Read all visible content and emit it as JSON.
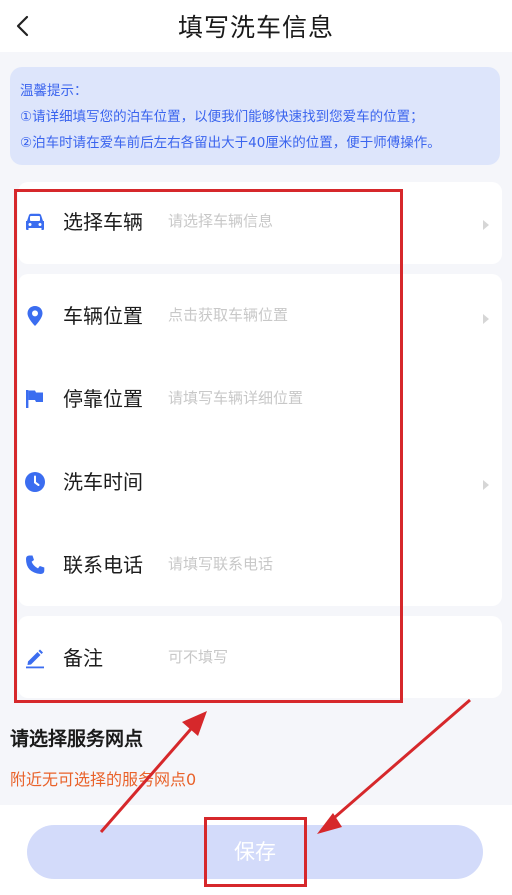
{
  "header": {
    "title": "填写洗车信息"
  },
  "tips": {
    "heading": "温馨提示：",
    "line1": "①请详细填写您的泊车位置，以便我们能够快速找到您爱车的位置；",
    "line2": "②泊车时请在爱车前后左右各留出大于40厘米的位置，便于师傅操作。"
  },
  "form": {
    "vehicle": {
      "label": "选择车辆",
      "placeholder": "请选择车辆信息",
      "icon": "car-icon"
    },
    "location": {
      "label": "车辆位置",
      "placeholder": "点击获取车辆位置",
      "icon": "location-pin-icon"
    },
    "parking": {
      "label": "停靠位置",
      "placeholder": "请填写车辆详细位置",
      "icon": "flag-icon"
    },
    "time": {
      "label": "洗车时间",
      "placeholder": "",
      "icon": "clock-icon"
    },
    "phone": {
      "label": "联系电话",
      "placeholder": "请填写联系电话",
      "icon": "phone-icon"
    },
    "remark": {
      "label": "备注",
      "placeholder": "可不填写",
      "icon": "pencil-icon"
    }
  },
  "service": {
    "title": "请选择服务网点",
    "empty_text": "附近无可选择的服务网点0"
  },
  "footer": {
    "save_label": "保存"
  },
  "colors": {
    "accent": "#3a64ee",
    "icon_blue": "#3b6df0",
    "warning": "#e9622a",
    "button_bg": "#d3dbfa",
    "annotation_red": "#d6282b"
  }
}
